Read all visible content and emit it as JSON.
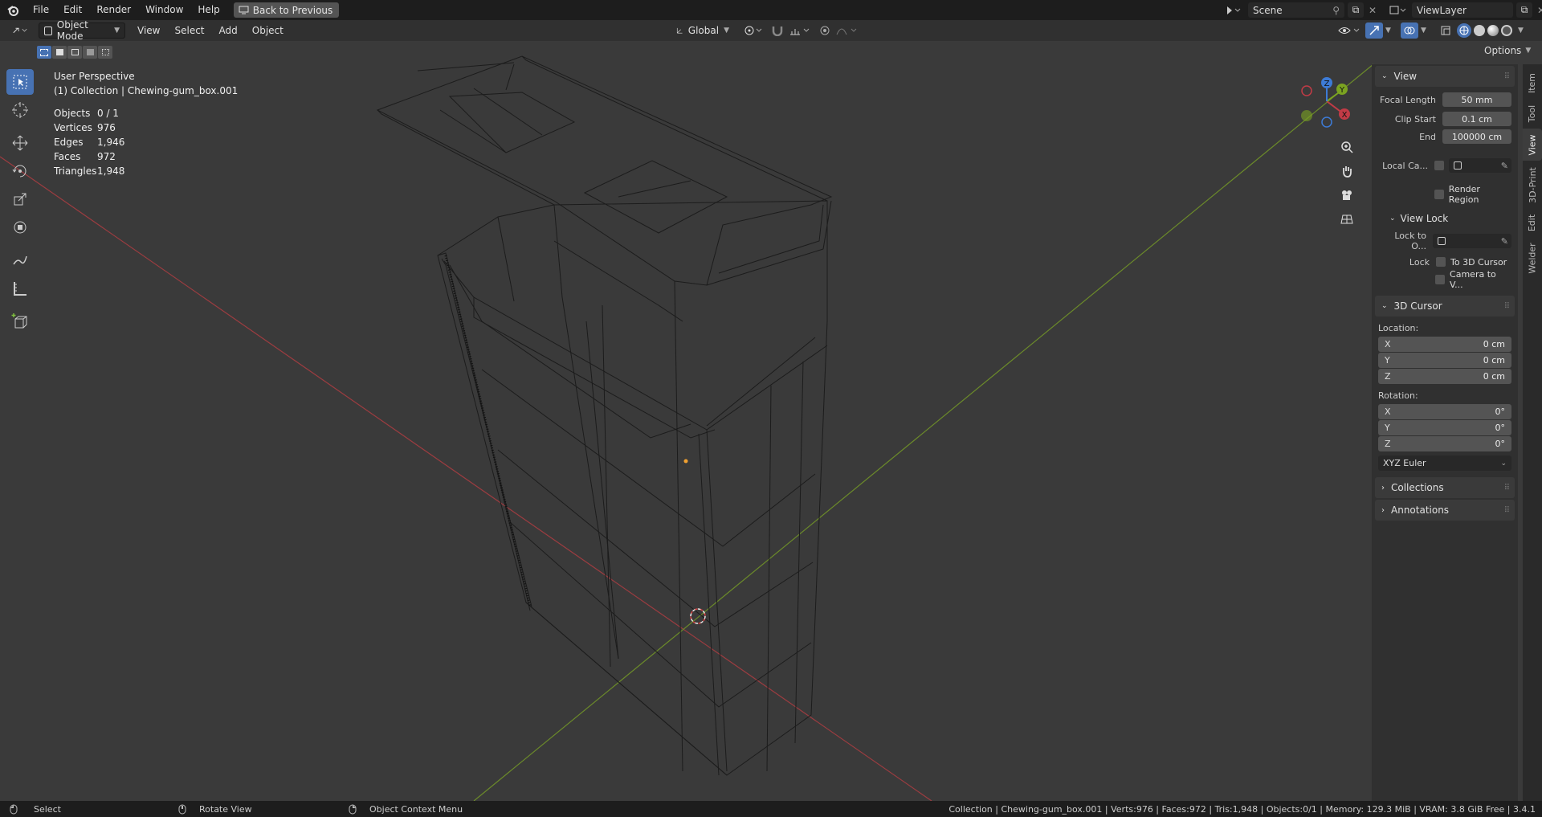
{
  "topbar": {
    "menu": [
      "File",
      "Edit",
      "Render",
      "Window",
      "Help"
    ],
    "back_button": "Back to Previous",
    "scene": "Scene",
    "view_layer": "ViewLayer"
  },
  "header": {
    "mode": "Object Mode",
    "menus": [
      "View",
      "Select",
      "Add",
      "Object"
    ],
    "transform_orientation": "Global",
    "options_label": "Options"
  },
  "overlay": {
    "perspective": "User Perspective",
    "collection": "(1) Collection | Chewing-gum_box.001"
  },
  "stats": [
    {
      "key": "Objects",
      "value": "0 / 1"
    },
    {
      "key": "Vertices",
      "value": "976"
    },
    {
      "key": "Edges",
      "value": "1,946"
    },
    {
      "key": "Faces",
      "value": "972"
    },
    {
      "key": "Triangles",
      "value": "1,948"
    }
  ],
  "gizmo": {
    "x": "X",
    "y": "Y",
    "z": "Z"
  },
  "npanel": {
    "tabs": [
      "Item",
      "Tool",
      "View",
      "3D-Print",
      "Edit",
      "Welder"
    ],
    "view_section": "View",
    "focal_length_label": "Focal Length",
    "focal_length": "50 mm",
    "clip_start_label": "Clip Start",
    "clip_start": "0.1 cm",
    "clip_end_label": "End",
    "clip_end": "100000 cm",
    "local_camera_label": "Local Ca...",
    "render_region_label": "Render Region",
    "view_lock_section": "View Lock",
    "lock_to_object_label": "Lock to O...",
    "lock_label": "Lock",
    "to_3d_cursor_label": "To 3D Cursor",
    "camera_to_view_label": "Camera to V...",
    "cursor_section": "3D Cursor",
    "location_label": "Location:",
    "location": [
      {
        "axis": "X",
        "value": "0 cm"
      },
      {
        "axis": "Y",
        "value": "0 cm"
      },
      {
        "axis": "Z",
        "value": "0 cm"
      }
    ],
    "rotation_label": "Rotation:",
    "rotation": [
      {
        "axis": "X",
        "value": "0°"
      },
      {
        "axis": "Y",
        "value": "0°"
      },
      {
        "axis": "Z",
        "value": "0°"
      }
    ],
    "rotation_mode": "XYZ Euler",
    "collections_section": "Collections",
    "annotations_section": "Annotations"
  },
  "statusbar": {
    "select": "Select",
    "rotate": "Rotate View",
    "context": "Object Context Menu",
    "info": "Collection | Chewing-gum_box.001 | Verts:976 | Faces:972 | Tris:1,948 | Objects:0/1 | Memory: 129.3 MiB | VRAM: 3.8 GiB Free | 3.4.1"
  },
  "colors": {
    "accent": "#4772b3",
    "x_axis": "#c23b46",
    "y_axis": "#7ba321",
    "z_axis": "#3d7bd6"
  }
}
